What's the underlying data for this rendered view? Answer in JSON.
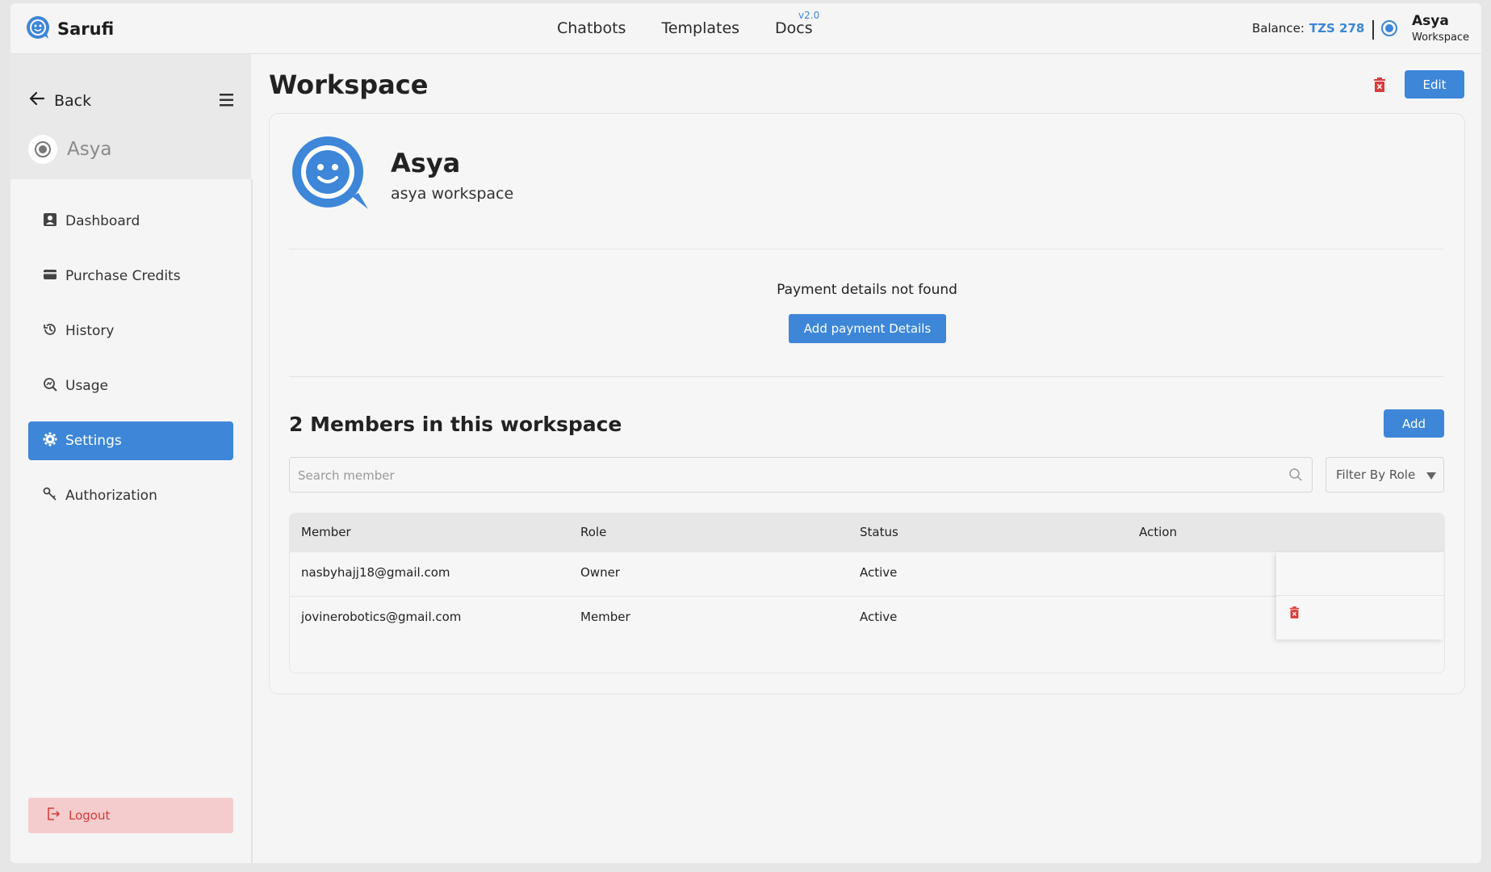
{
  "header": {
    "brand": "Sarufi",
    "nav": [
      {
        "label": "Chatbots"
      },
      {
        "label": "Templates"
      },
      {
        "label": "Docs",
        "badge": "v2.0"
      }
    ],
    "balance_label": "Balance:",
    "balance_value": "TZS 278",
    "workspace_name": "Asya",
    "workspace_sub": "Workspace"
  },
  "sidebar": {
    "back_label": "Back",
    "workspace_name": "Asya",
    "items": [
      {
        "label": "Dashboard",
        "icon": "dashboard-icon",
        "active": false
      },
      {
        "label": "Purchase Credits",
        "icon": "credit-card-icon",
        "active": false
      },
      {
        "label": "History",
        "icon": "history-icon",
        "active": false
      },
      {
        "label": "Usage",
        "icon": "usage-icon",
        "active": false
      },
      {
        "label": "Settings",
        "icon": "gear-icon",
        "active": true
      },
      {
        "label": "Authorization",
        "icon": "key-icon",
        "active": false
      }
    ],
    "logout_label": "Logout"
  },
  "main": {
    "title": "Workspace",
    "edit_label": "Edit",
    "workspace": {
      "name": "Asya",
      "description": "asya workspace"
    },
    "payment_message": "Payment details not found",
    "payment_button": "Add payment Details",
    "members_title": "2 Members in this workspace",
    "add_label": "Add",
    "search_placeholder": "Search member",
    "filter_label": "Filter By Role",
    "table": {
      "columns": [
        "Member",
        "Role",
        "Status",
        "Action"
      ],
      "rows": [
        {
          "member": "nasbyhajj18@gmail.com",
          "role": "Owner",
          "status": "Active"
        },
        {
          "member": "jovinerobotics@gmail.com",
          "role": "Member",
          "status": "Active"
        }
      ]
    }
  },
  "colors": {
    "accent": "#3d86d8",
    "danger": "#d83b3b",
    "logout_bg": "#f4cccd"
  }
}
